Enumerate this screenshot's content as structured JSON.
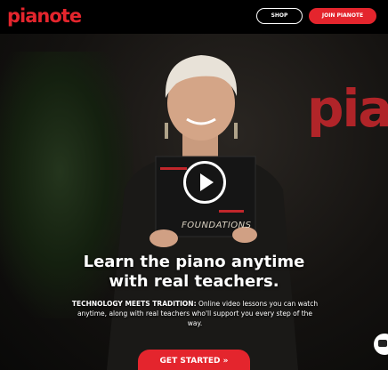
{
  "header": {
    "logo_text": "pianote",
    "shop_label": "SHOP",
    "join_label": "JOIN PIANOTE"
  },
  "hero": {
    "wall_sign_text": "pia",
    "book_text": "FOUNDATIONS",
    "headline_line1": "Learn the piano anytime",
    "headline_line2": "with real teachers.",
    "sub_bold": "TECHNOLOGY MEETS TRADITION:",
    "sub_rest": " Online video lessons you can watch anytime, along with real teachers who'll support you every step of the way.",
    "cta_label": "GET STARTED »"
  },
  "icons": {
    "play": "play-icon",
    "chat": "chat-icon"
  },
  "colors": {
    "brand_red": "#e4252d",
    "header_bg": "#000000"
  }
}
